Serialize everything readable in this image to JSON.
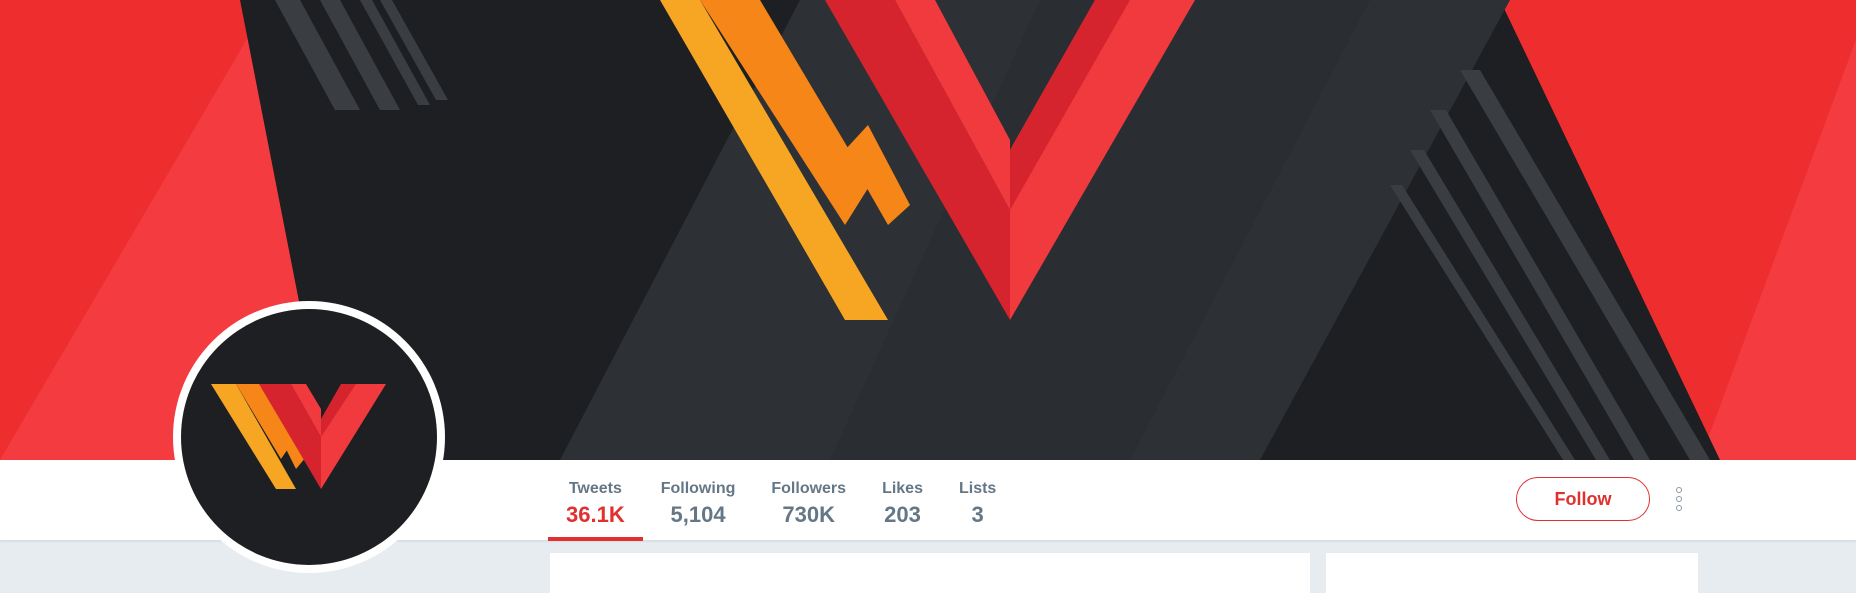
{
  "profile": {
    "stats": [
      {
        "label": "Tweets",
        "value": "36.1K",
        "active": true
      },
      {
        "label": "Following",
        "value": "5,104",
        "active": false
      },
      {
        "label": "Followers",
        "value": "730K",
        "active": false
      },
      {
        "label": "Likes",
        "value": "203",
        "active": false
      },
      {
        "label": "Lists",
        "value": "3",
        "active": false
      }
    ],
    "follow_label": "Follow",
    "more_icon": "more-vertical-icon"
  },
  "colors": {
    "accent": "#e0302f",
    "banner_red": "#f03a3e",
    "banner_dark": "#1d1f22",
    "logo_orange": "#f7a623",
    "stat_text": "#657786",
    "page_bg": "#e6ecf0"
  }
}
